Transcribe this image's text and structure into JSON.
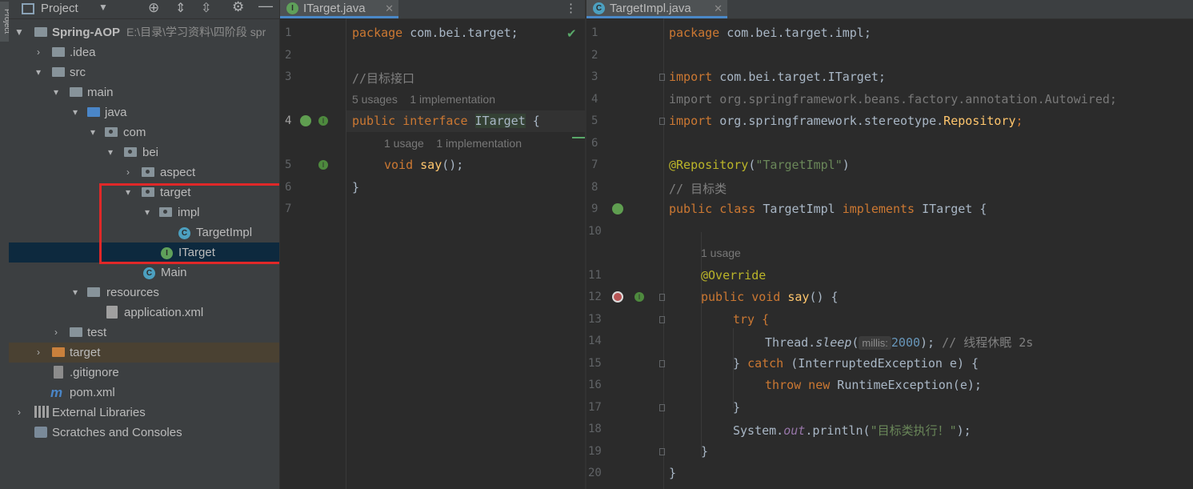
{
  "toolwindow": {
    "side_label": "Project"
  },
  "project_panel": {
    "title": "Project",
    "tree": [
      {
        "label": "Spring-AOP",
        "hint": "E:\\目录\\学习资料\\四阶段 spr"
      },
      {
        "label": ".idea"
      },
      {
        "label": "src"
      },
      {
        "label": "main"
      },
      {
        "label": "java"
      },
      {
        "label": "com"
      },
      {
        "label": "bei"
      },
      {
        "label": "aspect"
      },
      {
        "label": "target"
      },
      {
        "label": "impl"
      },
      {
        "label": "TargetImpl"
      },
      {
        "label": "ITarget"
      },
      {
        "label": "Main"
      },
      {
        "label": "resources"
      },
      {
        "label": "application.xml"
      },
      {
        "label": "test"
      },
      {
        "label": "target"
      },
      {
        "label": ".gitignore"
      },
      {
        "label": "pom.xml"
      },
      {
        "label": "External Libraries"
      },
      {
        "label": "Scratches and Consoles"
      }
    ]
  },
  "editor_left": {
    "tab": "ITarget.java",
    "lines": [
      "1",
      "2",
      "3",
      "4",
      "5",
      "6",
      "7"
    ],
    "code": {
      "l1_kw": "package",
      "l1_rest": " com.bei.target;",
      "l3": "//目标接口",
      "hint1": "5 usages    1 implementation",
      "l4_kw1": "public",
      "l4_kw2": " interface ",
      "l4_name": "ITarget",
      "l4_rest": " {",
      "hint2": "1 usage    1 implementation",
      "l5_kw": "void",
      "l5_fn": " say",
      "l5_rest": "();",
      "l6": "}"
    }
  },
  "editor_right": {
    "tab": "TargetImpl.java",
    "lines": [
      "1",
      "2",
      "3",
      "4",
      "5",
      "6",
      "7",
      "8",
      "9",
      "10",
      "11",
      "12",
      "13",
      "14",
      "15",
      "16",
      "17",
      "18",
      "19",
      "20"
    ],
    "code": {
      "l1_kw": "package",
      "l1_rest": " com.bei.target.impl;",
      "l3_kw": "import",
      "l3_rest": " com.bei.target.ITarget;",
      "l4": "import org.springframework.beans.factory.annotation.Autowired;",
      "l5_kw": "import",
      "l5_rest": " org.springframework.stereotype.",
      "l5_cls": "Repository",
      "l5_end": ";",
      "l7_ann": "@Repository",
      "l7_rest": "(",
      "l7_str": "\"TargetImpl\"",
      "l7_end": ")",
      "l8": "// 目标类",
      "l9_kw": "public class",
      "l9_name": " TargetImpl ",
      "l9_kw2": "implements",
      "l9_rest": " ITarget {",
      "hint": "1 usage",
      "l11": "@Override",
      "l12_kw": "public void",
      "l12_fn": " say",
      "l12_rest": "() {",
      "l13": "try {",
      "l14_a": "Thread.",
      "l14_b": "sleep",
      "l14_c": "(",
      "l14_param": "millis:",
      "l14_num": "2000",
      "l14_d": "); ",
      "l14_cm": "// 线程休眠 2s",
      "l15_a": "} ",
      "l15_kw": "catch",
      "l15_rest": " (InterruptedException e) {",
      "l16_kw": "throw new",
      "l16_rest": " RuntimeException(e);",
      "l17": "}",
      "l18_a": "System.",
      "l18_b": "out",
      "l18_c": ".println(",
      "l18_str": "\"目标类执行！\"",
      "l18_d": ");",
      "l19": "}",
      "l20": "}"
    }
  },
  "colors": {
    "highlight_box": "#e02828",
    "selection": "#0d293e",
    "accent_tab": "#4a88c7"
  }
}
